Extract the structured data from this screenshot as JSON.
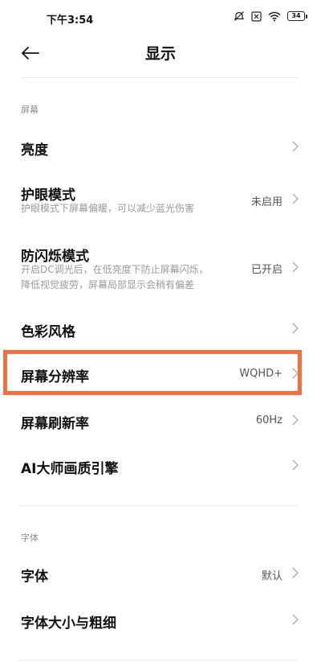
{
  "status_bar": {
    "time": "下午3:54",
    "battery": "34",
    "icons": [
      "mute-icon",
      "sim-off-icon",
      "wifi-icon",
      "battery-icon"
    ]
  },
  "header": {
    "title": "显示",
    "back_icon": "arrow-left-icon"
  },
  "sections": {
    "screen": {
      "title": "屏幕",
      "items": [
        {
          "title": "亮度",
          "subtitle": "",
          "value": ""
        },
        {
          "title": "护眼模式",
          "subtitle": "护眼模式下屏幕偏暖，可以减少蓝光伤害",
          "value": "未启用"
        },
        {
          "title": "防闪烁模式",
          "subtitle_line1": "开启DC调光后，在低亮度下防止屏幕闪烁，",
          "subtitle_line2": "降低视觉疲劳，屏幕局部显示会稍有偏差",
          "value": "已开启"
        },
        {
          "title": "色彩风格",
          "subtitle": "",
          "value": ""
        },
        {
          "title": "屏幕分辨率",
          "subtitle": "",
          "value": "WQHD+"
        },
        {
          "title": "屏幕刷新率",
          "subtitle": "",
          "value": "60Hz"
        },
        {
          "title": "AI大师画质引擎",
          "subtitle": "",
          "value": ""
        }
      ]
    },
    "font": {
      "title": "字体",
      "items": [
        {
          "title": "字体",
          "value": "默认"
        },
        {
          "title": "字体大小与粗细",
          "value": ""
        }
      ]
    }
  },
  "colors": {
    "highlight": "#f07040",
    "text_primary": "#111111",
    "text_secondary": "#9a9a9a"
  }
}
